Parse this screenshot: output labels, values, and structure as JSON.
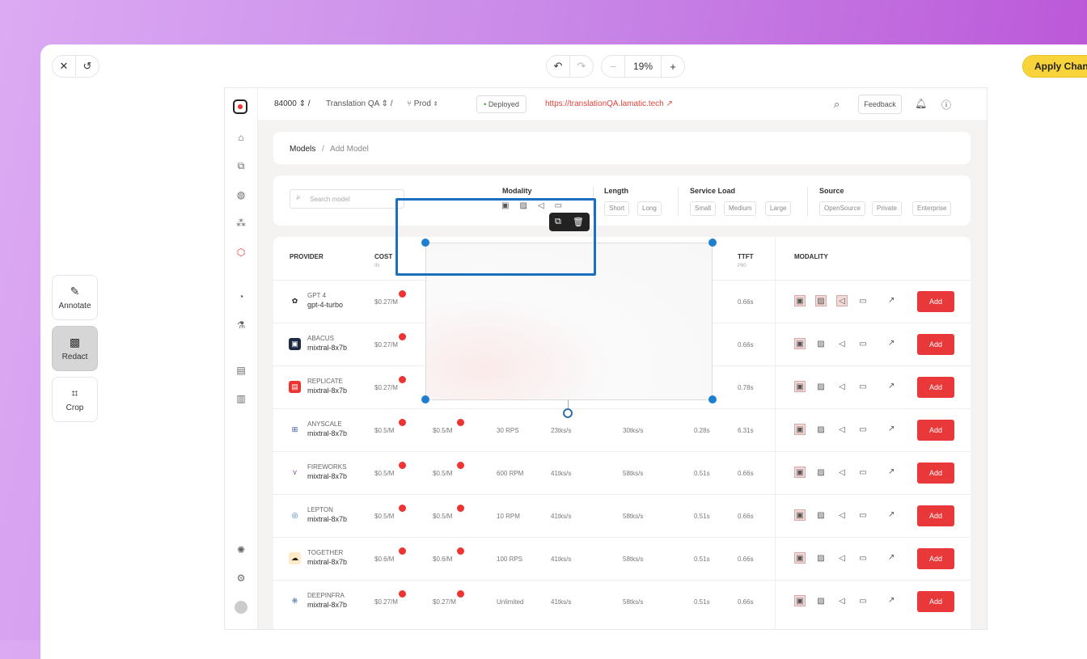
{
  "editor": {
    "zoom": "19%",
    "apply_label": "Apply Changes",
    "tools": [
      {
        "label": "Annotate",
        "icon": "pencil-icon"
      },
      {
        "label": "Redact",
        "icon": "redact-icon"
      },
      {
        "label": "Crop",
        "icon": "crop-icon"
      }
    ]
  },
  "app": {
    "workspace": "84000",
    "project": "Translation QA",
    "branch": "Prod",
    "status": "Deployed",
    "url": "https://translationQA.lamatic.tech",
    "feedback_label": "Feedback",
    "breadcrumb": {
      "root": "Models",
      "sep": "/",
      "current": "Add Model"
    },
    "search_placeholder": "Search model",
    "filters": {
      "modality_label": "Modality",
      "length_label": "Length",
      "length_options": [
        "Short",
        "Long"
      ],
      "service_label": "Service Load",
      "service_options": [
        "Small",
        "Medium",
        "Large"
      ],
      "source_label": "Source",
      "source_options": [
        "OpenSource",
        "Private",
        "Enterprise"
      ]
    },
    "table": {
      "headers": {
        "provider": "PROVIDER",
        "cost": "COST",
        "cost_sub": "IN",
        "ttft": "TTFT",
        "ttft_sub": "P90",
        "modality": "MODALITY"
      },
      "add_label": "Add",
      "rows": [
        {
          "provider": "GPT 4",
          "model": "gpt-4-turbo",
          "cost_in": "$0.27/M",
          "cost_out": "",
          "rate": "",
          "tps1": "",
          "tps2": "",
          "lat": "",
          "ttft": "0.66s"
        },
        {
          "provider": "ABACUS",
          "model": "mixtral-8x7b",
          "cost_in": "$0.27/M",
          "cost_out": "",
          "rate": "",
          "tps1": "",
          "tps2": "",
          "lat": "",
          "ttft": "0.66s"
        },
        {
          "provider": "REPLICATE",
          "model": "mixtral-8x7b",
          "cost_in": "$0.27/M",
          "cost_out": "",
          "rate": "",
          "tps1": "",
          "tps2": "",
          "lat": "",
          "ttft": "0.78s"
        },
        {
          "provider": "ANYSCALE",
          "model": "mixtral-8x7b",
          "cost_in": "$0.5/M",
          "cost_out": "$0.5/M",
          "rate": "30 RPS",
          "tps1": "23tks/s",
          "tps2": "30tks/s",
          "lat": "0.28s",
          "ttft": "6.31s"
        },
        {
          "provider": "FIREWORKS",
          "model": "mixtral-8x7b",
          "cost_in": "$0.5/M",
          "cost_out": "$0.5/M",
          "rate": "600 RPM",
          "tps1": "41tks/s",
          "tps2": "58tks/s",
          "lat": "0.51s",
          "ttft": "0.66s"
        },
        {
          "provider": "LEPTON",
          "model": "mixtral-8x7b",
          "cost_in": "$0.5/M",
          "cost_out": "$0.5/M",
          "rate": "10 RPM",
          "tps1": "41tks/s",
          "tps2": "58tks/s",
          "lat": "0.51s",
          "ttft": "0.66s"
        },
        {
          "provider": "TOGETHER",
          "model": "mixtral-8x7b",
          "cost_in": "$0.6/M",
          "cost_out": "$0.6/M",
          "rate": "100 RPS",
          "tps1": "41tks/s",
          "tps2": "58tks/s",
          "lat": "0.51s",
          "ttft": "0.66s"
        },
        {
          "provider": "DEEPINFRA",
          "model": "mixtral-8x7b",
          "cost_in": "$0.27/M",
          "cost_out": "$0.27/M",
          "rate": "Unlimited",
          "tps1": "41tks/s",
          "tps2": "58tks/s",
          "lat": "0.51s",
          "ttft": "0.66s"
        }
      ]
    }
  }
}
